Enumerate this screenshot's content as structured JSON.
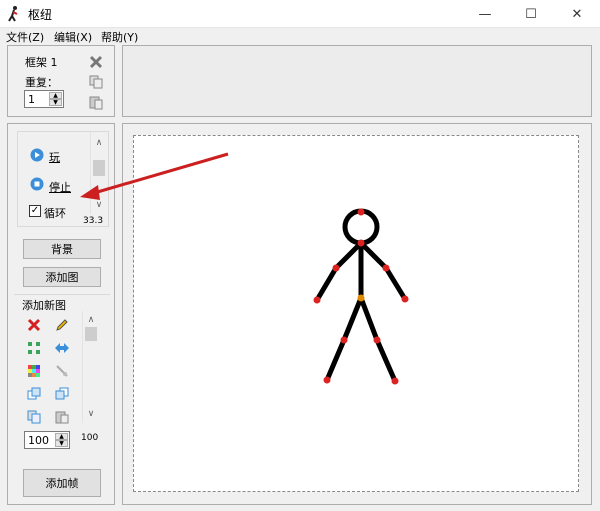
{
  "window": {
    "title": "枢纽",
    "controls": [
      "—",
      "☐",
      "✕"
    ]
  },
  "menu": [
    {
      "label": "文件(Z)"
    },
    {
      "label": "编辑(X)"
    },
    {
      "label": "帮助(Y)"
    }
  ],
  "frame_panel": {
    "frame_label": "框架 1",
    "repeat_label": "重复：",
    "repeat_value": "1"
  },
  "playback": {
    "play_label": "玩",
    "stop_label": "停止",
    "loop_label": "循环",
    "loop_checked": true,
    "fps": "33.3"
  },
  "buttons": {
    "background": "背景",
    "add_image": "添加图",
    "add_frame": "添加帧"
  },
  "figure_tools": {
    "title": "添加新图",
    "size_value": "100",
    "size_readout": "100"
  },
  "colors": {
    "arrow": "#cc1f1f",
    "joint": "#dd2222",
    "center_joint": "#e08a00",
    "figure": "#000000"
  }
}
